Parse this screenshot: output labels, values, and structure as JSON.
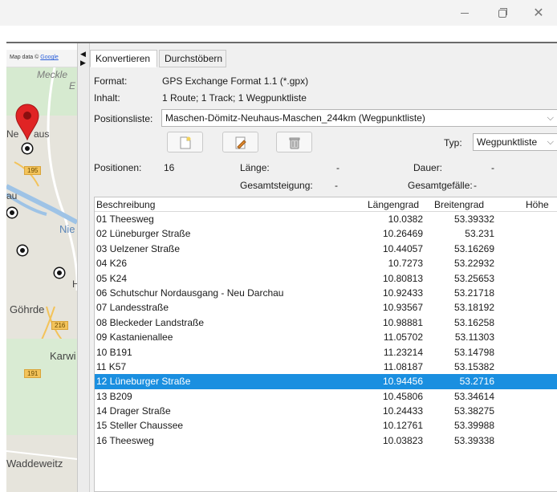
{
  "window": {
    "controls": {
      "minimize": "—",
      "maximize": "▢",
      "close": "✕"
    }
  },
  "map": {
    "attribution_prefix": "Map data ©",
    "attribution_link": "Google",
    "labels": [
      "Meckle",
      "E",
      "Ne",
      "aus",
      "au",
      "Nie",
      "H",
      "Göhrde",
      "Karwi",
      "Waddeweitz"
    ],
    "road_badges": [
      "195",
      "216",
      "191"
    ]
  },
  "splitter": {
    "arrow_left": "◀",
    "arrow_right": "▶"
  },
  "tabs": [
    {
      "label": "Konvertieren",
      "active": true
    },
    {
      "label": "Durchstöbern",
      "active": false
    }
  ],
  "info": {
    "format_label": "Format:",
    "format_value": "GPS Exchange Format 1.1 (*.gpx)",
    "content_label": "Inhalt:",
    "content_value": "1 Route; 1 Track; 1 Wegpunktliste",
    "positionslist_label": "Positionsliste:",
    "positionslist_value": "Maschen-Dömitz-Neuhaus-Maschen_244km (Wegpunktliste)",
    "type_label": "Typ:",
    "type_value": "Wegpunktliste"
  },
  "toolbar": {
    "buttons": [
      {
        "icon": "new-document-icon"
      },
      {
        "icon": "edit-document-icon"
      },
      {
        "icon": "trash-icon"
      }
    ]
  },
  "stats": {
    "positions_label": "Positionen:",
    "positions_value": "16",
    "length_label": "Länge:",
    "length_value": "-",
    "duration_label": "Dauer:",
    "duration_value": "-",
    "ascent_label": "Gesamtsteigung:",
    "ascent_value": "-",
    "descent_label": "Gesamtgefälle:",
    "descent_value": "-"
  },
  "table": {
    "columns": [
      "Beschreibung",
      "Längengrad",
      "Breitengrad",
      "Höhe"
    ],
    "rows": [
      {
        "desc": "01 Theesweg",
        "lon": "10.0382",
        "lat": "53.39332"
      },
      {
        "desc": "02 Lüneburger Straße",
        "lon": "10.26469",
        "lat": "53.231"
      },
      {
        "desc": "03 Uelzener Straße",
        "lon": "10.44057",
        "lat": "53.16269"
      },
      {
        "desc": "04 K26",
        "lon": "10.7273",
        "lat": "53.22932"
      },
      {
        "desc": "05 K24",
        "lon": "10.80813",
        "lat": "53.25653"
      },
      {
        "desc": "06 Schutschur Nordausgang - Neu Darchau",
        "lon": "10.92433",
        "lat": "53.21718"
      },
      {
        "desc": "07 Landesstraße",
        "lon": "10.93567",
        "lat": "53.18192"
      },
      {
        "desc": "08 Bleckeder Landstraße",
        "lon": "10.98881",
        "lat": "53.16258"
      },
      {
        "desc": "09 Kastanienallee",
        "lon": "11.05702",
        "lat": "53.11303"
      },
      {
        "desc": "10 B191",
        "lon": "11.23214",
        "lat": "53.14798"
      },
      {
        "desc": "11 K57",
        "lon": "11.08187",
        "lat": "53.15382"
      },
      {
        "desc": "12 Lüneburger Straße",
        "lon": "10.94456",
        "lat": "53.2716"
      },
      {
        "desc": "13 B209",
        "lon": "10.45806",
        "lat": "53.34614"
      },
      {
        "desc": "14 Drager Straße",
        "lon": "10.24433",
        "lat": "53.38275"
      },
      {
        "desc": "15 Steller Chaussee",
        "lon": "10.12761",
        "lat": "53.39988"
      },
      {
        "desc": "16 Theesweg",
        "lon": "10.03823",
        "lat": "53.39338"
      }
    ],
    "selected_index": 11,
    "selection_color": "#1a8fe0"
  }
}
